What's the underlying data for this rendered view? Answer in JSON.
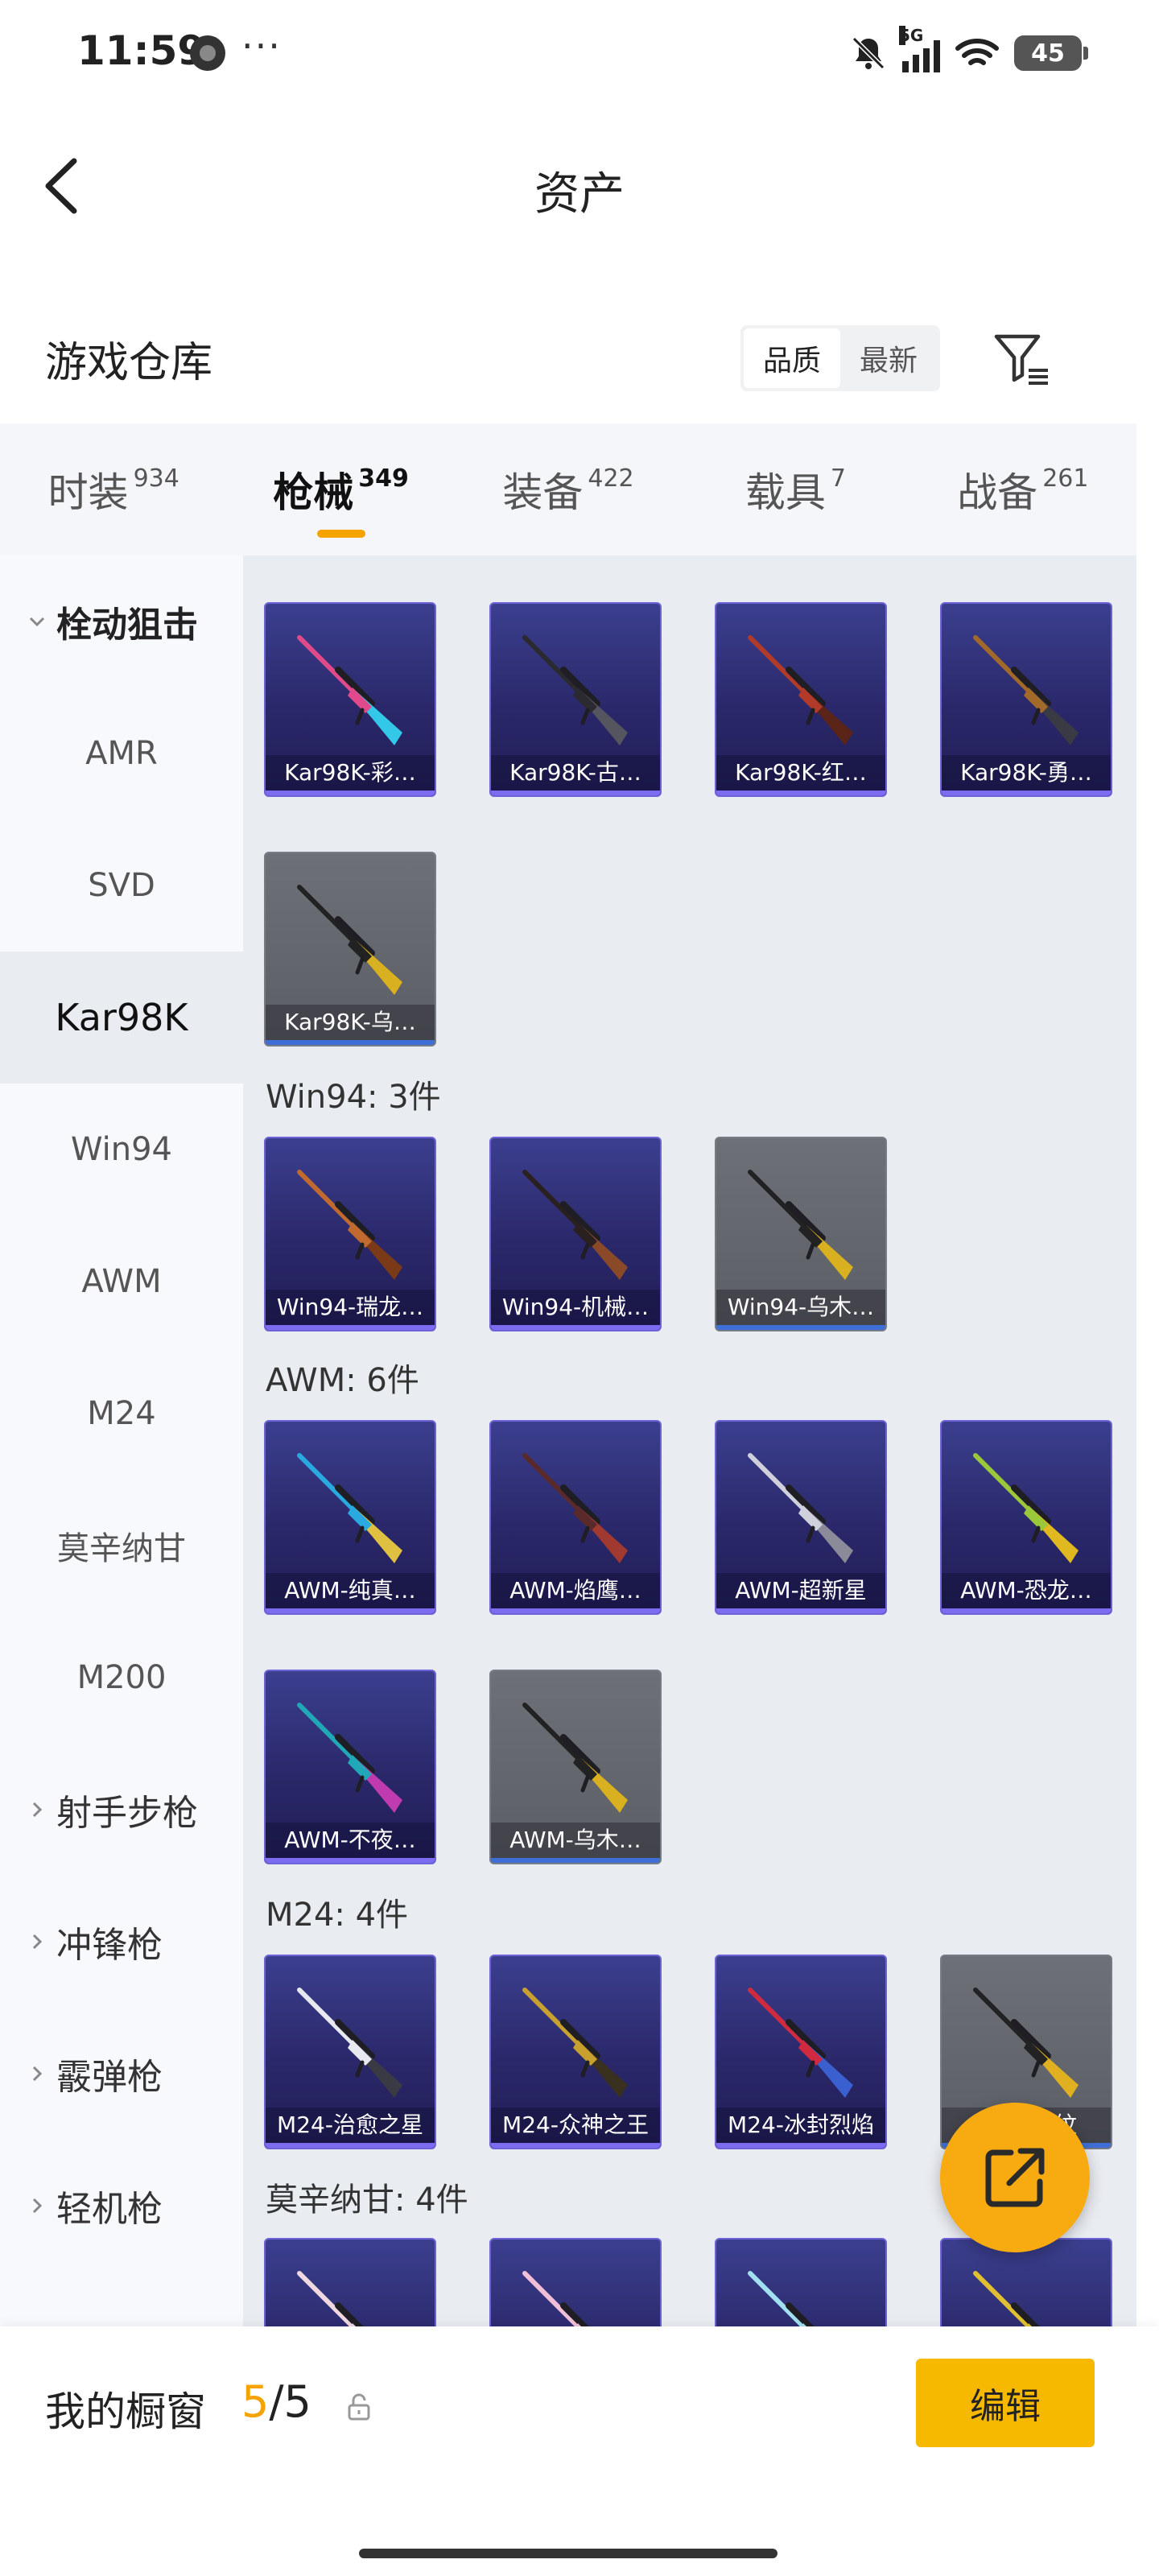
{
  "status_bar": {
    "time": "11:59",
    "more": "···",
    "network": "5G",
    "battery": "45"
  },
  "nav": {
    "title": "资产"
  },
  "warehouse": {
    "title": "游戏仓库",
    "sort_options": [
      "品质",
      "最新"
    ],
    "active_sort": "品质"
  },
  "tabs": [
    {
      "label": "时装",
      "count": "934"
    },
    {
      "label": "枪械",
      "count": "349",
      "active": true
    },
    {
      "label": "装备",
      "count": "422"
    },
    {
      "label": "载具",
      "count": "7"
    },
    {
      "label": "战备",
      "count": "261"
    }
  ],
  "sidebar": {
    "expanded_group": "栓动狙击",
    "sub_items": [
      "AMR",
      "SVD",
      "Kar98K",
      "Win94",
      "AWM",
      "M24",
      "莫辛纳甘",
      "M200"
    ],
    "selected": "Kar98K",
    "collapsed_groups": [
      "射手步枪",
      "冲锋枪",
      "霰弹枪",
      "轻机枪"
    ]
  },
  "sections": [
    {
      "label": "",
      "items": [
        {
          "name": "Kar98K-彩…",
          "rarity": "purple",
          "colors": [
            "#e04a8a",
            "#33c7e8"
          ]
        },
        {
          "name": "Kar98K-古…",
          "rarity": "purple",
          "colors": [
            "#2a2a30",
            "#555560"
          ]
        },
        {
          "name": "Kar98K-红…",
          "rarity": "purple",
          "colors": [
            "#b23a28",
            "#5a2418"
          ]
        },
        {
          "name": "Kar98K-勇…",
          "rarity": "purple",
          "colors": [
            "#a26a2a",
            "#3a3a44"
          ]
        },
        {
          "name": "Kar98K-乌…",
          "rarity": "gray",
          "colors": [
            "#222222",
            "#d8b020"
          ]
        }
      ]
    },
    {
      "label": "Win94: 3件",
      "items": [
        {
          "name": "Win94-瑞龙…",
          "rarity": "purple",
          "colors": [
            "#c06a30",
            "#7a3a18"
          ]
        },
        {
          "name": "Win94-机械…",
          "rarity": "purple",
          "colors": [
            "#2a2020",
            "#8a4a28"
          ]
        },
        {
          "name": "Win94-乌木…",
          "rarity": "gray",
          "colors": [
            "#222222",
            "#d8b020"
          ]
        }
      ]
    },
    {
      "label": "AWM: 6件",
      "items": [
        {
          "name": "AWM-纯真…",
          "rarity": "purple",
          "colors": [
            "#2aa8e0",
            "#e0c040"
          ]
        },
        {
          "name": "AWM-焰鹰…",
          "rarity": "purple",
          "colors": [
            "#5a2a2a",
            "#a03a30"
          ]
        },
        {
          "name": "AWM-超新星",
          "rarity": "purple",
          "colors": [
            "#d0d0dc",
            "#8a8a98"
          ]
        },
        {
          "name": "AWM-恐龙…",
          "rarity": "purple",
          "colors": [
            "#9ac83a",
            "#e0b820"
          ]
        },
        {
          "name": "AWM-不夜…",
          "rarity": "purple",
          "colors": [
            "#20a8b8",
            "#c03ab0"
          ]
        },
        {
          "name": "AWM-乌木…",
          "rarity": "gray",
          "colors": [
            "#222222",
            "#d8b020"
          ]
        }
      ]
    },
    {
      "label": "M24: 4件",
      "items": [
        {
          "name": "M24-治愈之星",
          "rarity": "purple",
          "colors": [
            "#e8e8f0",
            "#3a3a44"
          ]
        },
        {
          "name": "M24-众神之王",
          "rarity": "purple",
          "colors": [
            "#c8a030",
            "#3a3020"
          ]
        },
        {
          "name": "M24-冰封烈焰",
          "rarity": "purple",
          "colors": [
            "#d02a40",
            "#3a60d0"
          ]
        },
        {
          "name": "M24-金纹",
          "rarity": "gray",
          "colors": [
            "#222222",
            "#e0b020"
          ]
        }
      ]
    },
    {
      "label": "莫辛纳甘: 4件",
      "items": [
        {
          "name": "",
          "rarity": "purple",
          "colors": [
            "#f0d8e0",
            "#c0a0b0"
          ]
        },
        {
          "name": "",
          "rarity": "purple",
          "colors": [
            "#f0c0d8",
            "#d0d0e0"
          ]
        },
        {
          "name": "",
          "rarity": "purple",
          "colors": [
            "#a0e0f0",
            "#d0f0f8"
          ]
        },
        {
          "name": "",
          "rarity": "purple",
          "colors": [
            "#e0c030",
            "#222222"
          ]
        }
      ]
    }
  ],
  "showcase": {
    "label": "我的橱窗",
    "current": "5",
    "total": "/5",
    "edit": "编辑"
  },
  "colors": {
    "accent": "#f5a300",
    "edit_button": "#f7b800",
    "card_purple": "#2a286a",
    "card_gray": "#5c5e66"
  }
}
